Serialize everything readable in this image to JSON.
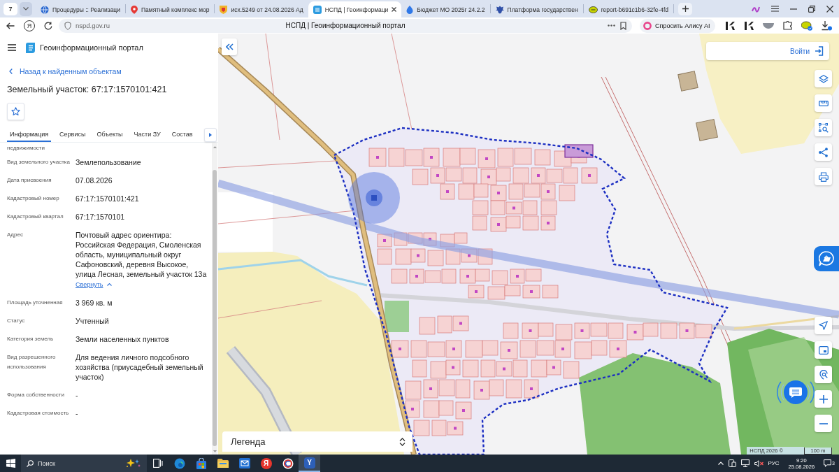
{
  "browser": {
    "tab_count": "7",
    "tabs": [
      {
        "title": "Процедуры :: Реализаци",
        "selected": false
      },
      {
        "title": "Памятный комплекс мор",
        "selected": false
      },
      {
        "title": "исх.5249 от 24.08.2026 Ад",
        "selected": false
      },
      {
        "title": "НСПД | Геоинформаци",
        "selected": true
      },
      {
        "title": "Бюджет МО 2025г 24.2.2",
        "selected": false
      },
      {
        "title": "Платформа государствен",
        "selected": false
      },
      {
        "title": "report-b691c1b6-32fe-4fd",
        "selected": false
      }
    ],
    "home_glyph": "Я",
    "address": "nspd.gov.ru",
    "page_title": "НСПД | Геоинформационный портал",
    "alice_button": "Спросить Алису AI"
  },
  "portal": {
    "title": "Геоинформационный портал",
    "back_link": "Назад к найденным объектам",
    "heading": "Земельный участок: 67:17:1570101:421",
    "tabs": [
      {
        "label": "Информация",
        "selected": true
      },
      {
        "label": "Сервисы",
        "selected": false
      },
      {
        "label": "Объекты",
        "selected": false
      },
      {
        "label": "Части ЗУ",
        "selected": false
      },
      {
        "label": "Состав",
        "selected": false
      }
    ],
    "clipped_label": "недвижимости",
    "fields": [
      {
        "label": "Вид земельного участка",
        "value": "Землепользование"
      },
      {
        "label": "Дата присвоения",
        "value": "07.08.2026"
      },
      {
        "label": "Кадастровый номер",
        "value": "67:17:1570101:421"
      },
      {
        "label": "Кадастровый квартал",
        "value": "67:17:1570101"
      },
      {
        "label": "Адрес",
        "value": "Почтовый адрес ориентира: Российская Федерация, Смоленская область, муниципальный округ Сафоновский, деревня Высокое, улица Лесная, земельный участок 13а",
        "link": "Свернуть"
      },
      {
        "label": "Площадь уточненная",
        "value": "3 969 кв. м"
      },
      {
        "label": "Статус",
        "value": "Учтенный"
      },
      {
        "label": "Категория земель",
        "value": "Земли населенных пунктов"
      },
      {
        "label": "Вид разрешенного использования",
        "value": "Для ведения личного подсобного хозяйства (приусадебный земельный участок)"
      },
      {
        "label": "Форма собственности",
        "value": "-"
      },
      {
        "label": "Кадастровая стоимость",
        "value": "-"
      }
    ]
  },
  "map": {
    "login": "Войти",
    "legend": "Легенда",
    "attribution": "НСПД 2026 ©",
    "scale": "100 m"
  },
  "taskbar": {
    "search_placeholder": "Поиск",
    "app_glyph": "Я",
    "active_app_glyph": "Y",
    "language": "РУС",
    "time": "9:20",
    "date": "25.08.2026",
    "notifications": "3"
  }
}
